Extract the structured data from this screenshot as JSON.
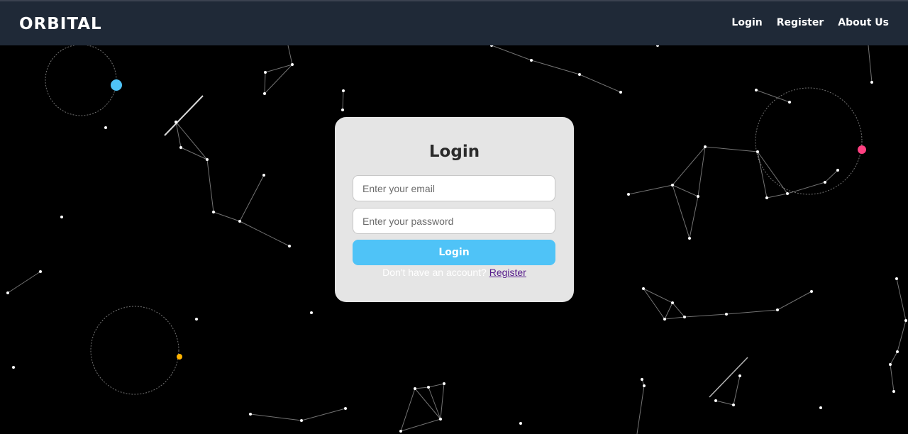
{
  "header": {
    "brand": "ORBITAL",
    "nav": [
      {
        "label": "Login"
      },
      {
        "label": "Register"
      },
      {
        "label": "About Us"
      }
    ]
  },
  "login_card": {
    "title": "Login",
    "email_placeholder": "Enter your email",
    "password_placeholder": "Enter your password",
    "submit_label": "Login",
    "prompt_text": "Don't have an account?",
    "register_link": "Register"
  },
  "colors": {
    "background": "#000000",
    "header_bg": "#1f2937",
    "card_bg": "#e5e5e5",
    "accent_button": "#4fc3f7",
    "orbit_blue": "#4fc3f7",
    "orbit_pink": "#ff4081",
    "orbit_amber": "#ffb300"
  }
}
